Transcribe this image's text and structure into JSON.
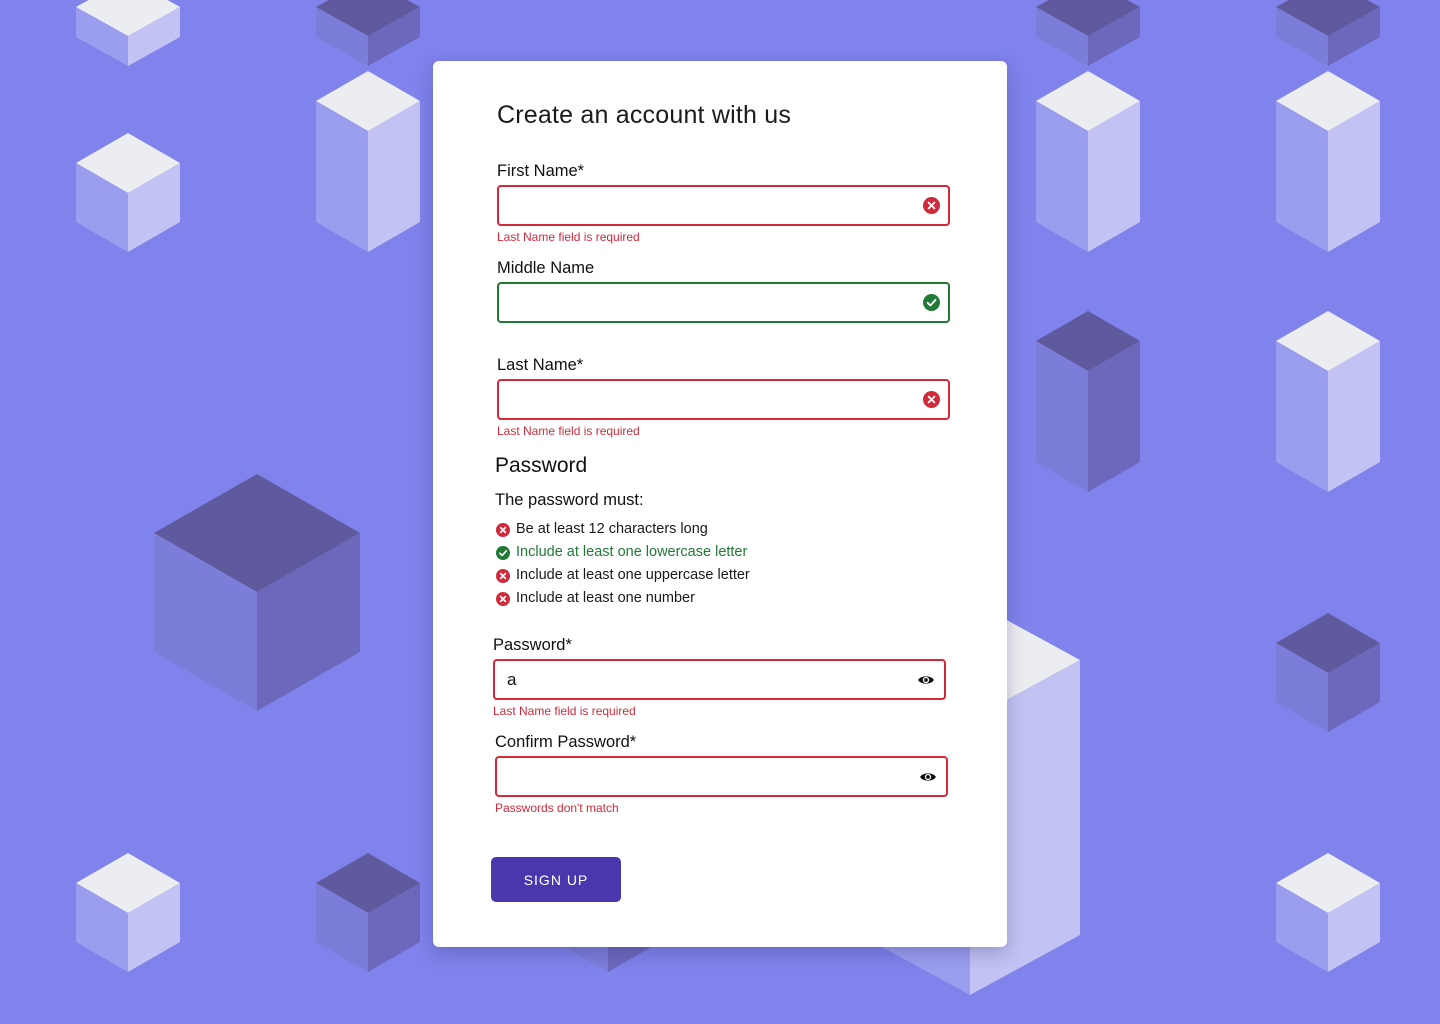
{
  "colors": {
    "background": "#7f83eb",
    "card": "#ffffff",
    "error": "#d02a3b",
    "success": "#1f7a35",
    "primary_button": "#4b37ad"
  },
  "form": {
    "title": "Create an account with us",
    "first_name": {
      "label": "First Name*",
      "value": "",
      "state": "error",
      "error": "Last Name field is required"
    },
    "middle_name": {
      "label": "Middle Name",
      "value": "",
      "state": "valid"
    },
    "last_name": {
      "label": "Last Name*",
      "value": "",
      "state": "error",
      "error": "Last Name field is required"
    },
    "password_section": {
      "title": "Password",
      "intro": "The password must:",
      "rules": [
        {
          "text": "Be at least 12 characters long",
          "met": false
        },
        {
          "text": "Include at least one lowercase letter",
          "met": true
        },
        {
          "text": "Include at least one uppercase letter",
          "met": false
        },
        {
          "text": "Include at least one number",
          "met": false
        }
      ]
    },
    "password": {
      "label": "Password*",
      "value": "a",
      "state": "error",
      "error": "Last Name field is required",
      "icon": "eye-icon"
    },
    "confirm_password": {
      "label": "Confirm Password*",
      "value": "",
      "state": "error",
      "error": "Passwords don't match",
      "icon": "eye-icon"
    },
    "submit_label": "SIGN UP"
  }
}
